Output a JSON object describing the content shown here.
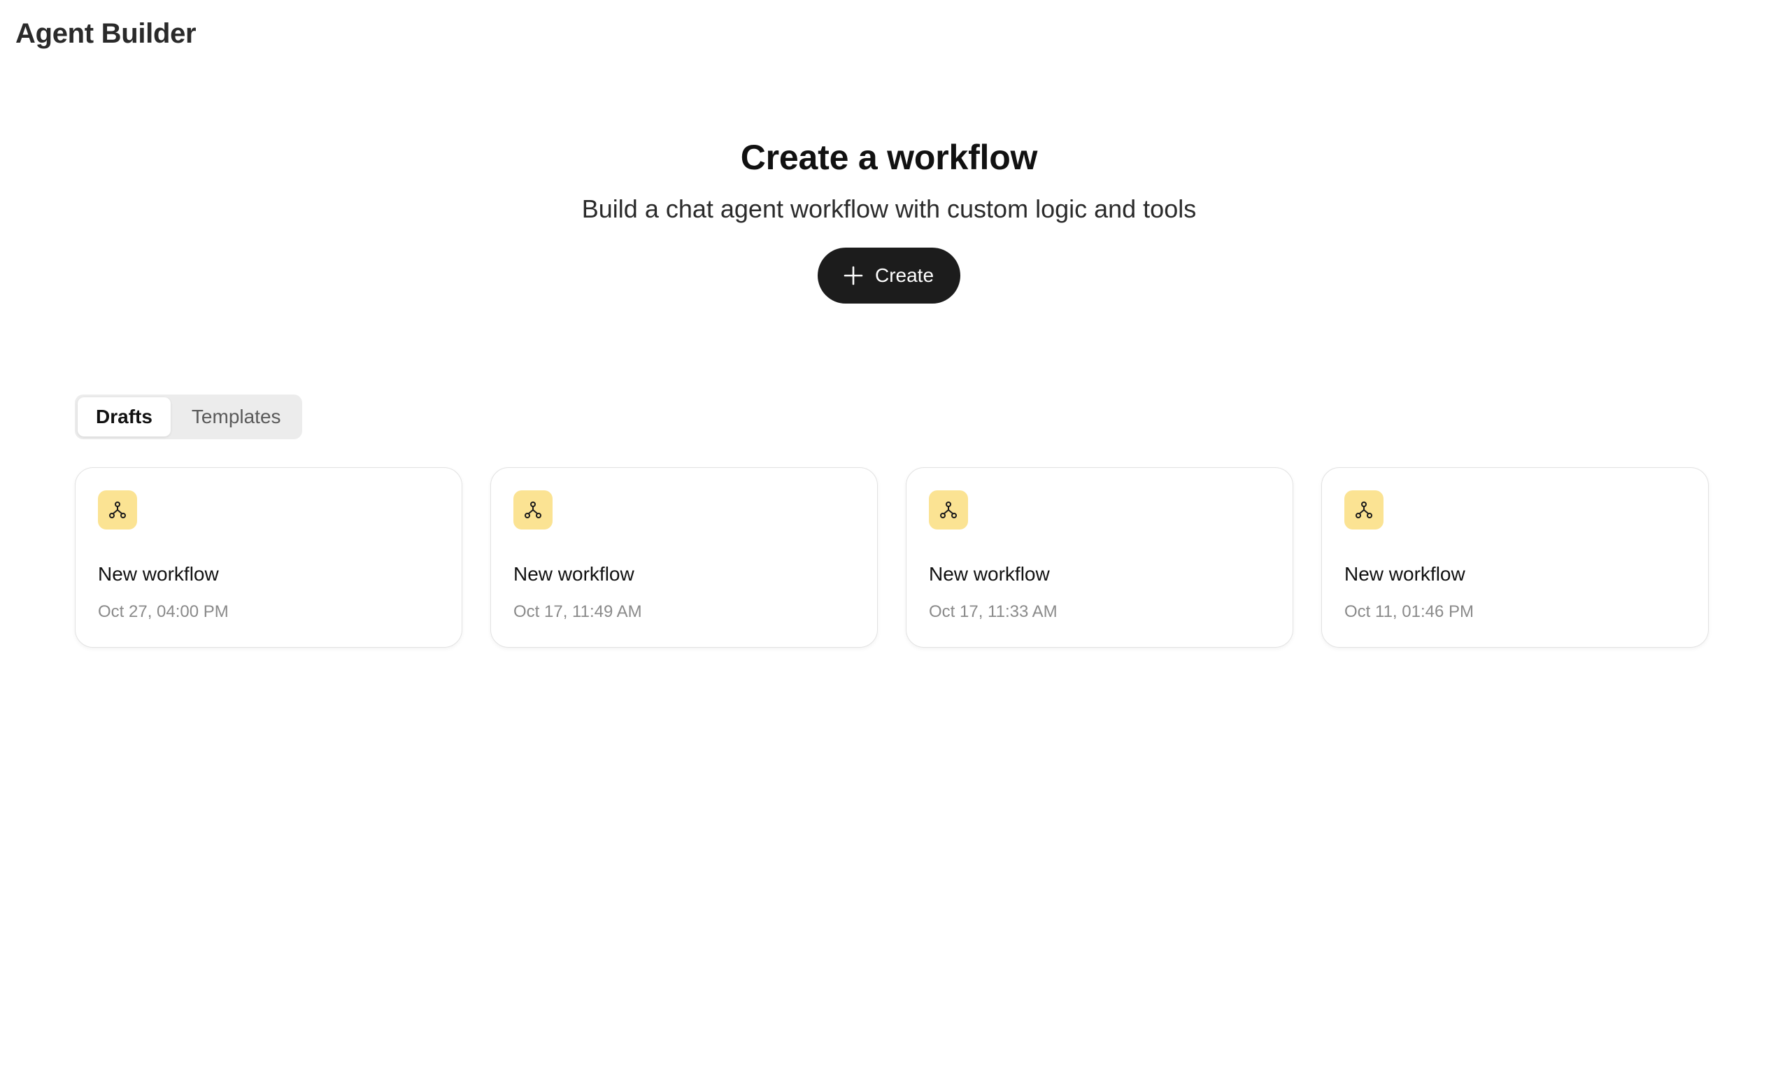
{
  "app": {
    "title": "Agent Builder"
  },
  "hero": {
    "title": "Create a workflow",
    "subtitle": "Build a chat agent workflow with custom logic and tools",
    "create_label": "Create"
  },
  "tabs": [
    {
      "label": "Drafts",
      "active": true
    },
    {
      "label": "Templates",
      "active": false
    }
  ],
  "drafts": [
    {
      "icon": "workflow-icon",
      "title": "New workflow",
      "date": "Oct 27, 04:00 PM"
    },
    {
      "icon": "workflow-icon",
      "title": "New workflow",
      "date": "Oct 17, 11:49 AM"
    },
    {
      "icon": "workflow-icon",
      "title": "New workflow",
      "date": "Oct 17, 11:33 AM"
    },
    {
      "icon": "workflow-icon",
      "title": "New workflow",
      "date": "Oct 11, 01:46 PM"
    }
  ],
  "colors": {
    "accent_button": "#1c1c1c",
    "workflow_icon_bg": "#fbe393",
    "tab_bar_bg": "#ececec"
  }
}
